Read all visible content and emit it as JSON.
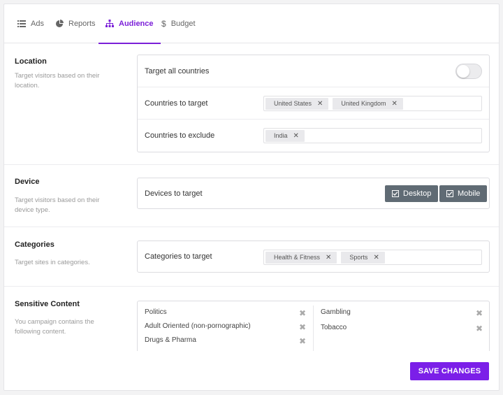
{
  "tabs": [
    {
      "label": "Ads",
      "icon": "list-icon"
    },
    {
      "label": "Reports",
      "icon": "pie-chart-icon"
    },
    {
      "label": "Audience",
      "icon": "sitemap-icon",
      "active": true
    },
    {
      "label": "Budget",
      "icon": "dollar-icon"
    }
  ],
  "location": {
    "title": "Location",
    "description": "Target visitors based on their location.",
    "target_all_label": "Target all countries",
    "target_all_on": false,
    "countries_to_target_label": "Countries to target",
    "countries_to_target": [
      "United States",
      "United Kingdom"
    ],
    "countries_to_exclude_label": "Countries to exclude",
    "countries_to_exclude": [
      "India"
    ]
  },
  "device": {
    "title": "Device",
    "description": "Target visitors based on their device type.",
    "label": "Devices to target",
    "options": [
      "Desktop",
      "Mobile"
    ]
  },
  "categories": {
    "title": "Categories",
    "description": "Target sites in categories.",
    "label": "Categories to target",
    "selected": [
      "Health & Fitness",
      "Sports"
    ]
  },
  "sensitive": {
    "title": "Sensitive Content",
    "description": "You campaign contains the following content.",
    "left_items": [
      "Politics",
      "Adult Oriented (non-pornographic)",
      "Drugs & Pharma"
    ],
    "right_items": [
      "Gambling",
      "Tobacco"
    ]
  },
  "save_label": "SAVE CHANGES",
  "colors": {
    "accent": "#7b1fe8",
    "device_button": "#606b74"
  }
}
